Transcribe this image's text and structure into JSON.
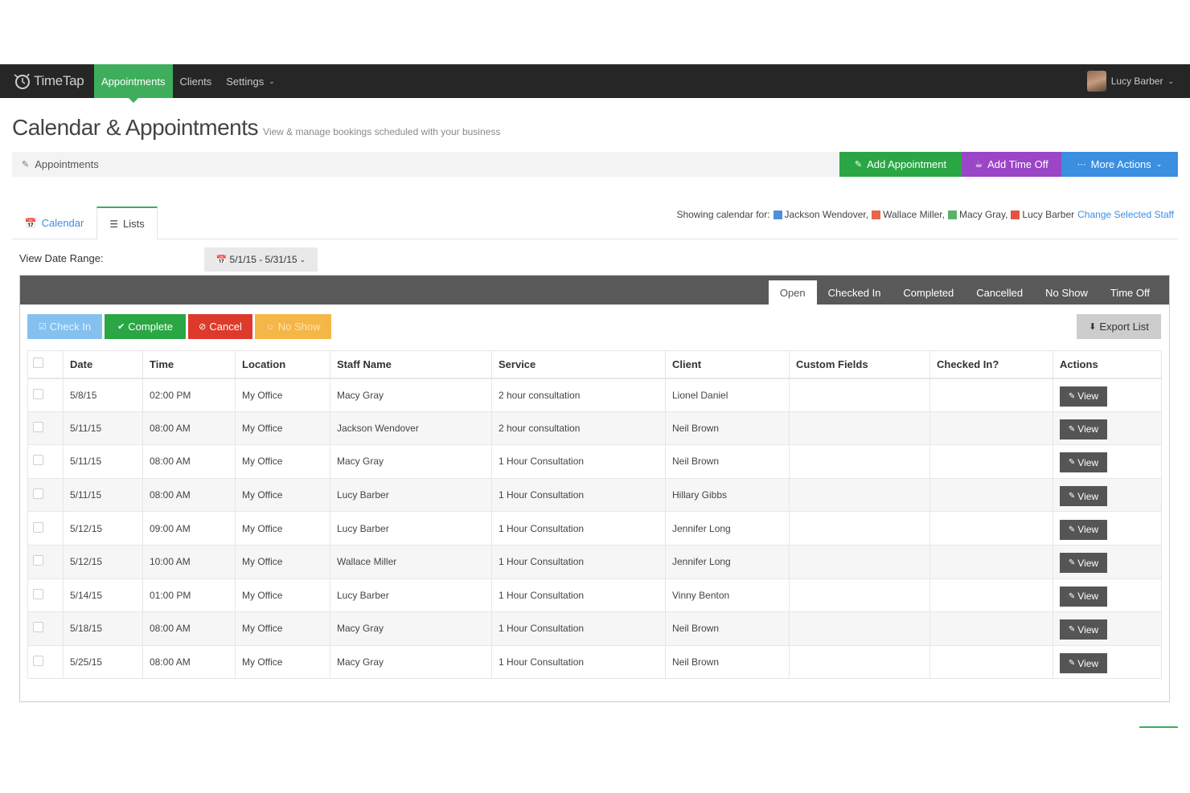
{
  "nav": {
    "logo": "TimeTap",
    "items": [
      {
        "label": "Appointments",
        "active": true
      },
      {
        "label": "Clients",
        "active": false
      },
      {
        "label": "Settings",
        "active": false
      }
    ],
    "user_name": "Lucy Barber"
  },
  "header": {
    "title": "Calendar & Appointments",
    "subtitle": "View & manage bookings scheduled with your business",
    "breadcrumb": "Appointments"
  },
  "actions": {
    "add_appointment": "Add Appointment",
    "add_time_off": "Add Time Off",
    "more_actions": "More Actions"
  },
  "view_tabs": {
    "calendar": "Calendar",
    "lists": "Lists"
  },
  "showing": {
    "label": "Showing calendar for:",
    "staff": [
      {
        "name": "Jackson Wendover,",
        "color": "#4f8fdc"
      },
      {
        "name": "Wallace Miller,",
        "color": "#e8664a"
      },
      {
        "name": "Macy Gray,",
        "color": "#5bb36b"
      },
      {
        "name": "Lucy Barber",
        "color": "#e2543e"
      }
    ],
    "change_link": "Change Selected Staff"
  },
  "date_range": {
    "label": "View Date Range:",
    "value": "5/1/15 - 5/31/15"
  },
  "status_tabs": [
    "Open",
    "Checked In",
    "Completed",
    "Cancelled",
    "No Show",
    "Time Off"
  ],
  "toolbar": {
    "check_in": "Check In",
    "complete": "Complete",
    "cancel": "Cancel",
    "no_show": "No Show",
    "export": "Export List"
  },
  "table": {
    "columns": [
      "Date",
      "Time",
      "Location",
      "Staff Name",
      "Service",
      "Client",
      "Custom Fields",
      "Checked In?",
      "Actions"
    ],
    "view_label": "View",
    "rows": [
      {
        "date": "5/8/15",
        "time": "02:00 PM",
        "location": "My Office",
        "staff": "Macy Gray",
        "service": "2 hour consultation",
        "client": "Lionel Daniel"
      },
      {
        "date": "5/11/15",
        "time": "08:00 AM",
        "location": "My Office",
        "staff": "Jackson Wendover",
        "service": "2 hour consultation",
        "client": "Neil Brown"
      },
      {
        "date": "5/11/15",
        "time": "08:00 AM",
        "location": "My Office",
        "staff": "Macy Gray",
        "service": "1 Hour Consultation",
        "client": "Neil Brown"
      },
      {
        "date": "5/11/15",
        "time": "08:00 AM",
        "location": "My Office",
        "staff": "Lucy Barber",
        "service": "1 Hour Consultation",
        "client": "Hillary Gibbs"
      },
      {
        "date": "5/12/15",
        "time": "09:00 AM",
        "location": "My Office",
        "staff": "Lucy Barber",
        "service": "1 Hour Consultation",
        "client": "Jennifer Long"
      },
      {
        "date": "5/12/15",
        "time": "10:00 AM",
        "location": "My Office",
        "staff": "Wallace Miller",
        "service": "1 Hour Consultation",
        "client": "Jennifer Long"
      },
      {
        "date": "5/14/15",
        "time": "01:00 PM",
        "location": "My Office",
        "staff": "Lucy Barber",
        "service": "1 Hour Consultation",
        "client": "Vinny Benton"
      },
      {
        "date": "5/18/15",
        "time": "08:00 AM",
        "location": "My Office",
        "staff": "Macy Gray",
        "service": "1 Hour Consultation",
        "client": "Neil Brown"
      },
      {
        "date": "5/25/15",
        "time": "08:00 AM",
        "location": "My Office",
        "staff": "Macy Gray",
        "service": "1 Hour Consultation",
        "client": "Neil Brown"
      }
    ]
  }
}
